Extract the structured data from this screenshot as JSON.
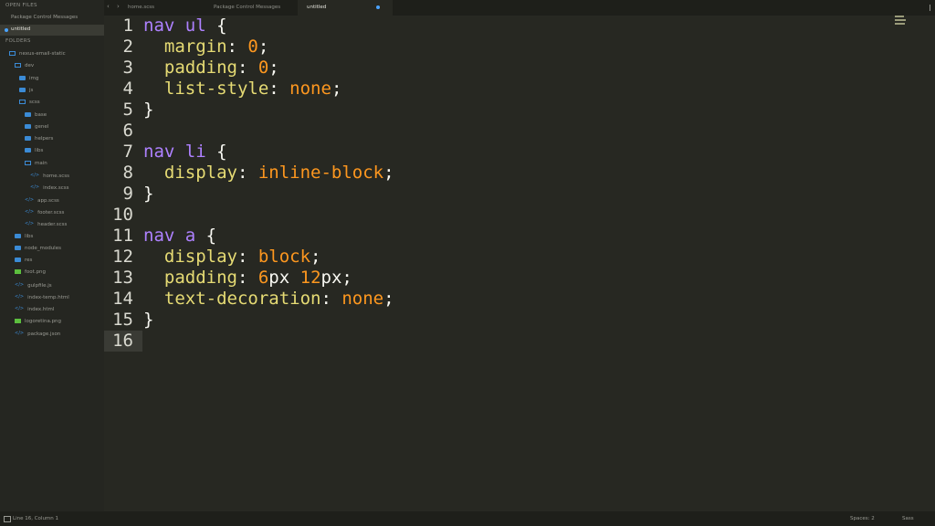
{
  "sidebar": {
    "open_files_header": "OPEN FILES",
    "open_files": [
      "Package Control Messages",
      "untitled"
    ],
    "folders_header": "FOLDERS",
    "tree": [
      {
        "label": "nexus-email-static",
        "icon": "folder-open-icon"
      },
      {
        "label": "dev",
        "icon": "folder-open-icon"
      },
      {
        "label": "img",
        "icon": "folder-icon"
      },
      {
        "label": "js",
        "icon": "folder-icon"
      },
      {
        "label": "scss",
        "icon": "folder-open-icon"
      },
      {
        "label": "base",
        "icon": "folder-icon"
      },
      {
        "label": "genel",
        "icon": "folder-icon"
      },
      {
        "label": "helpers",
        "icon": "folder-icon"
      },
      {
        "label": "libs",
        "icon": "folder-icon"
      },
      {
        "label": "main",
        "icon": "folder-open-icon"
      },
      {
        "label": "home.scss",
        "icon": "code-file-icon"
      },
      {
        "label": "index.scss",
        "icon": "code-file-icon"
      },
      {
        "label": "app.scss",
        "icon": "code-file-icon"
      },
      {
        "label": "footer.scss",
        "icon": "code-file-icon"
      },
      {
        "label": "header.scss",
        "icon": "code-file-icon"
      },
      {
        "label": "libs",
        "icon": "folder-icon"
      },
      {
        "label": "node_modules",
        "icon": "folder-icon"
      },
      {
        "label": "res",
        "icon": "folder-icon"
      },
      {
        "label": "foot.png",
        "icon": "image-file-icon"
      },
      {
        "label": "gulpfile.js",
        "icon": "code-file-icon"
      },
      {
        "label": "index-temp.html",
        "icon": "code-file-icon"
      },
      {
        "label": "index.html",
        "icon": "code-file-icon"
      },
      {
        "label": "logoretina.png",
        "icon": "image-file-icon"
      },
      {
        "label": "package.json",
        "icon": "code-file-icon"
      }
    ]
  },
  "tabs": [
    {
      "label": "home.scss",
      "active": false
    },
    {
      "label": "Package Control Messages",
      "active": false
    },
    {
      "label": "untitled",
      "active": true,
      "modified": true
    }
  ],
  "editor": {
    "current_line": 16,
    "lines": [
      [
        [
          "sel",
          "nav ul "
        ],
        [
          "pun",
          "{"
        ]
      ],
      [
        [
          "prop",
          "  margin"
        ],
        [
          "pun",
          ": "
        ],
        [
          "val",
          "0"
        ],
        [
          "pun",
          ";"
        ]
      ],
      [
        [
          "prop",
          "  padding"
        ],
        [
          "pun",
          ": "
        ],
        [
          "val",
          "0"
        ],
        [
          "pun",
          ";"
        ]
      ],
      [
        [
          "prop",
          "  list-style"
        ],
        [
          "pun",
          ": "
        ],
        [
          "val",
          "none"
        ],
        [
          "pun",
          ";"
        ]
      ],
      [
        [
          "pun",
          "}"
        ]
      ],
      [],
      [
        [
          "sel",
          "nav li "
        ],
        [
          "pun",
          "{"
        ]
      ],
      [
        [
          "prop",
          "  display"
        ],
        [
          "pun",
          ": "
        ],
        [
          "val",
          "inline-block"
        ],
        [
          "pun",
          ";"
        ]
      ],
      [
        [
          "pun",
          "}"
        ]
      ],
      [],
      [
        [
          "sel",
          "nav a "
        ],
        [
          "pun",
          "{"
        ]
      ],
      [
        [
          "prop",
          "  display"
        ],
        [
          "pun",
          ": "
        ],
        [
          "val",
          "block"
        ],
        [
          "pun",
          ";"
        ]
      ],
      [
        [
          "prop",
          "  padding"
        ],
        [
          "pun",
          ": "
        ],
        [
          "val",
          "6"
        ],
        [
          "unit",
          "px "
        ],
        [
          "val",
          "12"
        ],
        [
          "unit",
          "px"
        ],
        [
          "pun",
          ";"
        ]
      ],
      [
        [
          "prop",
          "  text-decoration"
        ],
        [
          "pun",
          ": "
        ],
        [
          "val",
          "none"
        ],
        [
          "pun",
          ";"
        ]
      ],
      [
        [
          "pun",
          "}"
        ]
      ],
      []
    ]
  },
  "statusbar": {
    "position": "Line 16, Column 1",
    "spaces": "Spaces: 2",
    "syntax": "Sass"
  },
  "colors": {
    "background": "#272822",
    "selector": "#ae81ff",
    "property": "#e6db74",
    "value": "#fd971f",
    "punctuation": "#f8f8f2",
    "accent": "#4aa3ff"
  }
}
